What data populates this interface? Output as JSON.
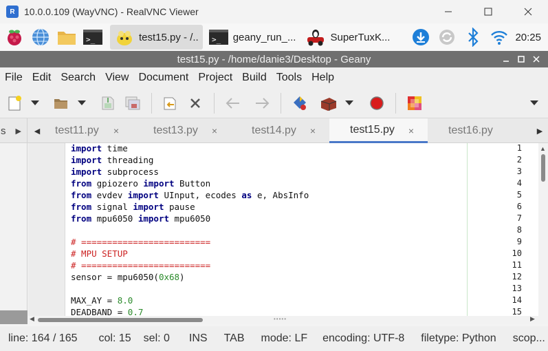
{
  "vnc": {
    "title": "10.0.0.109 (WayVNC) - RealVNC Viewer",
    "logo": "R"
  },
  "taskbar": {
    "tasks": [
      {
        "label": "test15.py - /..",
        "icon": "geany-icon",
        "active": true
      },
      {
        "label": "geany_run_...",
        "icon": "terminal-icon",
        "active": false
      },
      {
        "label": "SuperTuxK...",
        "icon": "supertuxkart-icon",
        "active": false
      }
    ],
    "clock": "20:25"
  },
  "geany": {
    "title": "test15.py - /home/danie3/Desktop - Geany"
  },
  "menu": {
    "items": [
      "File",
      "Edit",
      "Search",
      "View",
      "Document",
      "Project",
      "Build",
      "Tools",
      "Help"
    ]
  },
  "tabs": {
    "side_tab": "s",
    "items": [
      {
        "label": "test11.py",
        "active": false
      },
      {
        "label": "test13.py",
        "active": false
      },
      {
        "label": "test14.py",
        "active": false
      },
      {
        "label": "test15.py",
        "active": true
      },
      {
        "label": "test16.py",
        "active": false
      }
    ],
    "close_glyph": "×"
  },
  "editor": {
    "lines": [
      {
        "n": "1",
        "text": "import time"
      },
      {
        "n": "2",
        "text": "import threading"
      },
      {
        "n": "3",
        "text": "import subprocess"
      },
      {
        "n": "4",
        "text": "from gpiozero import Button"
      },
      {
        "n": "5",
        "text": "from evdev import UInput, ecodes as e, AbsInfo"
      },
      {
        "n": "6",
        "text": "from signal import pause"
      },
      {
        "n": "7",
        "text": "from mpu6050 import mpu6050"
      },
      {
        "n": "8",
        "text": ""
      },
      {
        "n": "9",
        "text": "# ========================="
      },
      {
        "n": "10",
        "text": "# MPU SETUP"
      },
      {
        "n": "11",
        "text": "# ========================="
      },
      {
        "n": "12",
        "text": "sensor = mpu6050(0x68)"
      },
      {
        "n": "13",
        "text": ""
      },
      {
        "n": "14",
        "text": "MAX_AY = 8.0"
      },
      {
        "n": "15",
        "text": "DEADBAND = 0.7"
      }
    ]
  },
  "status": {
    "line": "line: 164 / 165",
    "col": "col: 15",
    "sel": "sel: 0",
    "ins": "INS",
    "tab": "TAB",
    "mode": "mode: LF",
    "encoding": "encoding: UTF-8",
    "filetype": "filetype: Python",
    "scope": "scop..."
  },
  "colors": {
    "keyword": "#000080",
    "comment": "#cc2222",
    "number": "#2a8a2a",
    "tab_accent": "#4a78c8",
    "title_bar": "#6f6f6f"
  }
}
